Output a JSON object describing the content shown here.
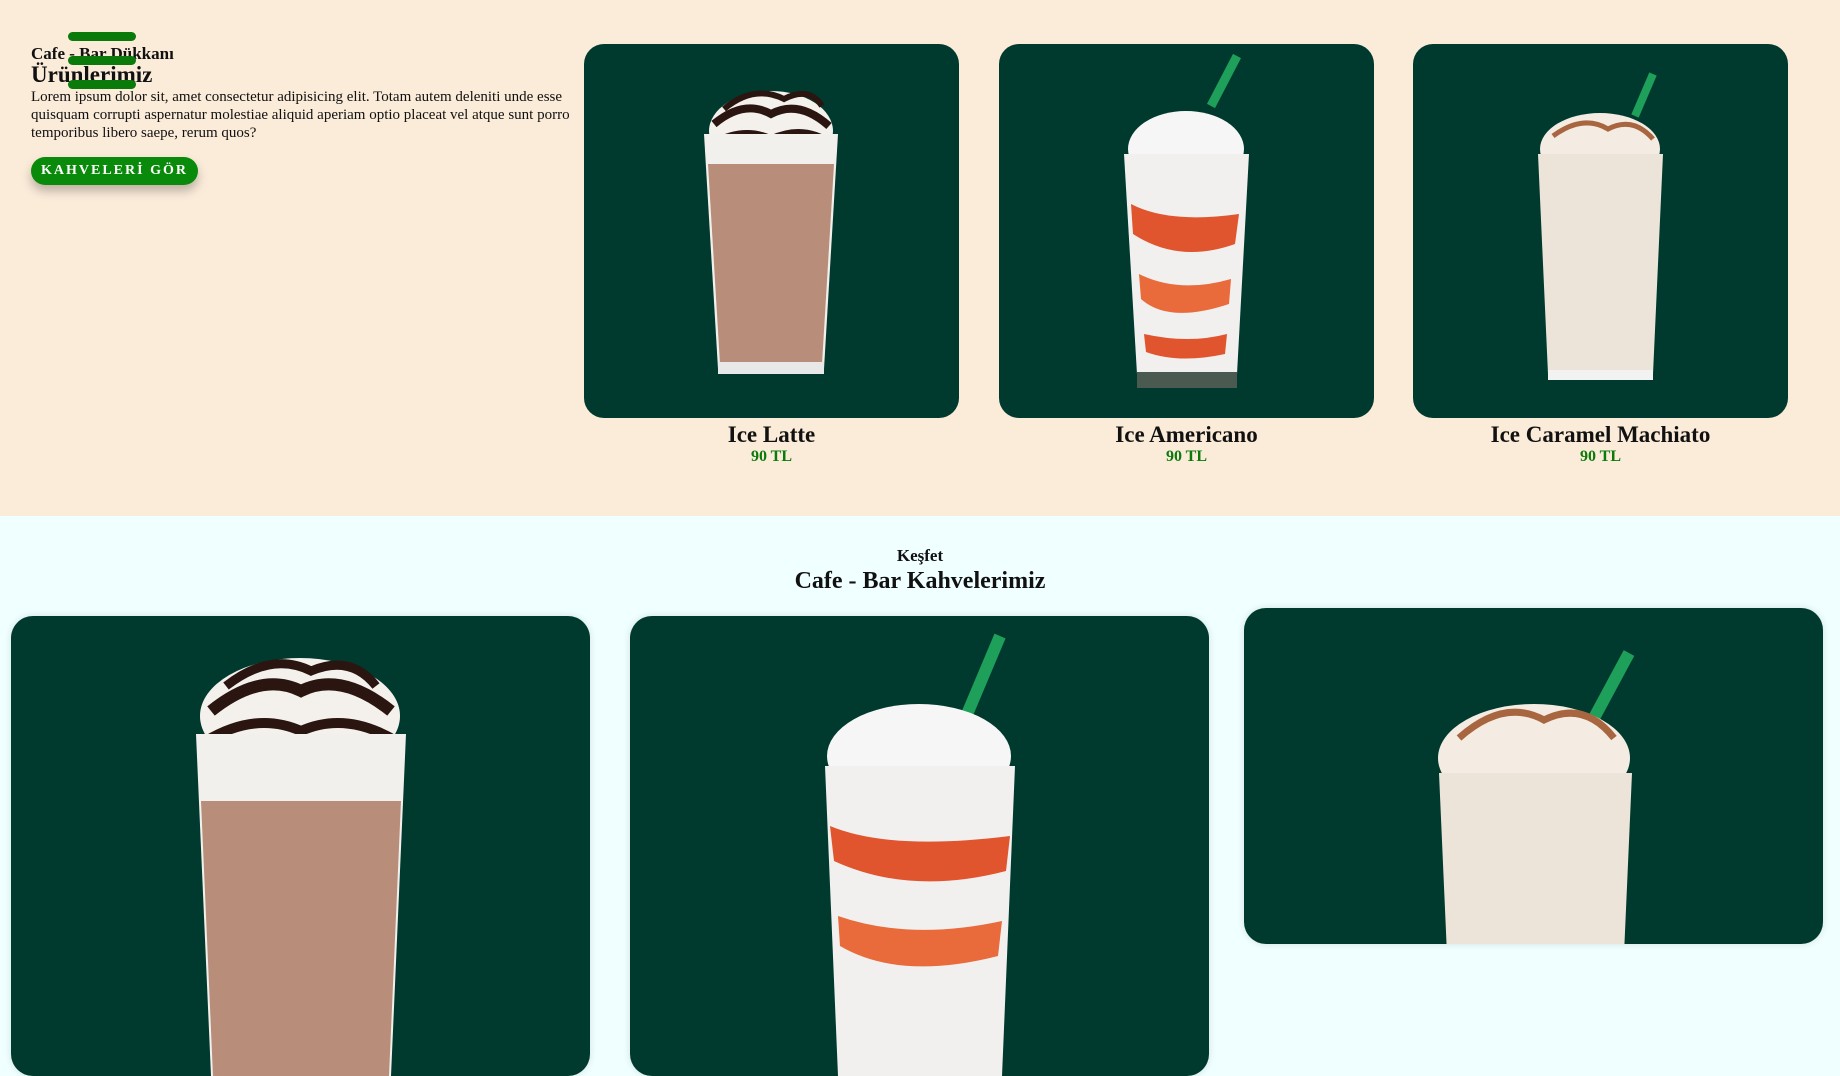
{
  "hero": {
    "subtitle": "Cafe - Bar Dükkanı",
    "title": "Ürünlerimiz",
    "description": "Lorem ipsum dolor sit, amet consectetur adipisicing elit. Totam autem deleniti unde esse quisquam corrupti aspernatur molestiae aliquid aperiam optio placeat vel atque sunt porro temporibus libero saepe, rerum quos?",
    "button_label": "KAHVELERİ GÖR"
  },
  "products": [
    {
      "name": "Ice Latte",
      "price": "90 TL"
    },
    {
      "name": "Ice Americano",
      "price": "90 TL"
    },
    {
      "name": "Ice Caramel Machiato",
      "price": "90 TL"
    }
  ],
  "discover": {
    "kicker": "Keşfet",
    "title": "Cafe - Bar Kahvelerimiz"
  },
  "colors": {
    "hero_bg": "#fbebd9",
    "page_bg": "#f0ffff",
    "card_bg": "#003a2e",
    "accent_green": "#0a8a0a",
    "price_green": "#0a7a0a"
  },
  "icons": [
    "hamburger-menu-icon"
  ]
}
